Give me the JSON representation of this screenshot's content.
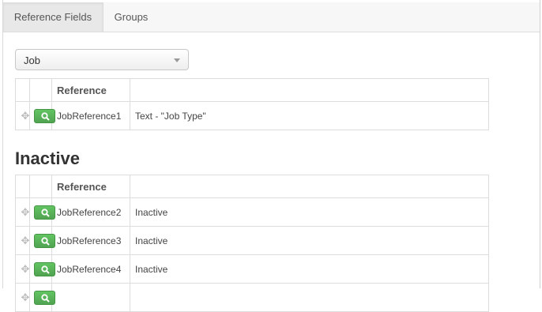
{
  "tabs": [
    {
      "label": "Reference Fields",
      "active": true
    },
    {
      "label": "Groups",
      "active": false
    }
  ],
  "select": {
    "value": "Job"
  },
  "active_table": {
    "header": {
      "reference": "Reference",
      "detail": ""
    },
    "rows": [
      {
        "reference": "JobReference1",
        "detail": "Text - \"Job Type\""
      }
    ]
  },
  "inactive_section": {
    "title": "Inactive",
    "header": {
      "reference": "Reference",
      "detail": ""
    },
    "rows": [
      {
        "reference": "JobReference2",
        "detail": "Inactive"
      },
      {
        "reference": "JobReference3",
        "detail": "Inactive"
      },
      {
        "reference": "JobReference4",
        "detail": "Inactive"
      },
      {
        "reference": "",
        "detail": ""
      }
    ]
  },
  "colors": {
    "button_green": "#5bb75b",
    "border": "#dddddd"
  },
  "icons": {
    "drag": "move-arrows-icon",
    "search": "magnifier-icon"
  }
}
